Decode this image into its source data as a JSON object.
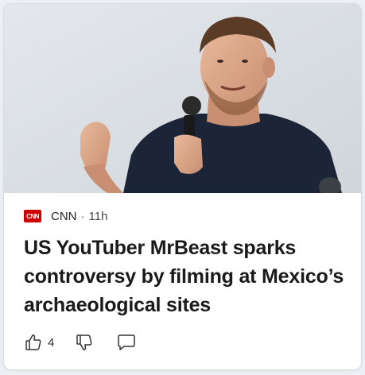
{
  "article": {
    "source": "CNN",
    "logo_text": "CNN",
    "separator": "·",
    "age": "11h",
    "headline": "US YouTuber MrBeast sparks controversy by filming at Mexico’s archaeological sites",
    "image_description_icon": "photo-of-man-with-microphone"
  },
  "actions": {
    "like_count": "4",
    "like_icon": "thumbs-up-icon",
    "dislike_icon": "thumbs-down-icon",
    "comment_icon": "comment-icon"
  },
  "colors": {
    "logo_red": "#cc0000",
    "headline": "#1a1a1a",
    "background": "#eceff3"
  }
}
